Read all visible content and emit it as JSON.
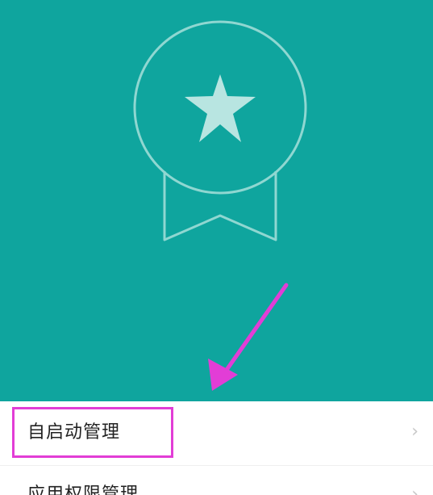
{
  "colors": {
    "hero_background": "#0fa59e",
    "badge_stroke": "#8fd7d1",
    "star_fill": "#b8e5e1",
    "annotation": "#e23dd6",
    "list_text": "#222222",
    "chevron": "#c8c8c8"
  },
  "hero": {
    "icon": "badge-star-icon",
    "annotation_icon": "arrow-icon"
  },
  "list": {
    "items": [
      {
        "label": "自启动管理",
        "icon": "chevron-right-icon",
        "highlighted": true
      },
      {
        "label": "应用权限管理",
        "icon": "chevron-right-icon",
        "highlighted": false
      }
    ]
  }
}
